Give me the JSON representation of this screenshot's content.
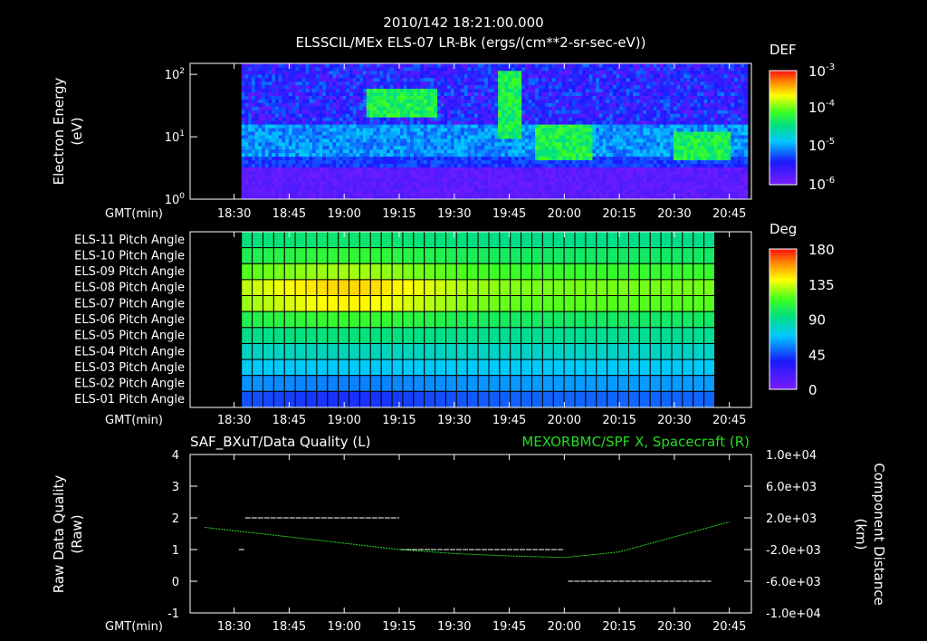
{
  "header": {
    "timestamp": "2010/142 18:21:00.000",
    "subtitle": "ELSSCIL/MEx ELS-07 LR-Bk  (ergs/(cm**2-sr-sec-eV))"
  },
  "colors": {
    "background": "#000000",
    "foreground": "#ffffff",
    "right_axis_title": "#22dd22"
  },
  "time_axis": {
    "label": "GMT(min)",
    "ticks": [
      "18:30",
      "18:45",
      "19:00",
      "19:15",
      "19:30",
      "19:45",
      "20:00",
      "20:15",
      "20:30",
      "20:45"
    ],
    "range_min": [
      18.3,
      20.85
    ]
  },
  "panel1": {
    "ylabel_line1": "Electron Energy",
    "ylabel_line2": "(eV)",
    "y_ticks": [
      {
        "base": "10",
        "exp": "0",
        "value": 1
      },
      {
        "base": "10",
        "exp": "1",
        "value": 10
      },
      {
        "base": "10",
        "exp": "2",
        "value": 100
      }
    ],
    "colorbar_title": "DEF",
    "colorbar_ticks": [
      {
        "base": "10",
        "exp": "-3"
      },
      {
        "base": "10",
        "exp": "-4"
      },
      {
        "base": "10",
        "exp": "-5"
      },
      {
        "base": "10",
        "exp": "-6"
      }
    ]
  },
  "panel2": {
    "row_labels": [
      "ELS-11 Pitch Angle",
      "ELS-10 Pitch Angle",
      "ELS-09 Pitch Angle",
      "ELS-08 Pitch Angle",
      "ELS-07 Pitch Angle",
      "ELS-06 Pitch Angle",
      "ELS-05 Pitch Angle",
      "ELS-04 Pitch Angle",
      "ELS-03 Pitch Angle",
      "ELS-02 Pitch Angle",
      "ELS-01 Pitch Angle"
    ],
    "colorbar_title": "Deg",
    "colorbar_ticks": [
      "180",
      "135",
      "90",
      "45",
      "0"
    ],
    "colorbar_range": [
      0,
      180
    ]
  },
  "panel3": {
    "left_title": "SAF_BXuT/Data Quality (L)",
    "right_title": "MEXORBMC/SPF X, Spacecraft (R)",
    "ylabel_left_line1": "Raw Data Quality",
    "ylabel_left_line2": "(Raw)",
    "ylabel_right_line1": "Component Distance",
    "ylabel_right_line2": "(km)",
    "left_ticks": [
      "4",
      "3",
      "2",
      "1",
      "0",
      "-1"
    ],
    "right_ticks": [
      "1.0e+04",
      "6.0e+03",
      "2.0e+03",
      "-2.0e+03",
      "-6.0e+03",
      "-1.0e+04"
    ]
  },
  "chart_data": [
    {
      "type": "heatmap",
      "title": "ELSSCIL/MEx ELS-07 LR-Bk  (ergs/(cm**2-sr-sec-eV))",
      "ylabel": "Electron Energy (eV)",
      "xlabel": "GMT(min)",
      "ylim": [
        1,
        150
      ],
      "y_scale": "log",
      "color_scale": "log",
      "color_range": [
        1e-06,
        0.001
      ],
      "data_start": "18:32",
      "features": [
        {
          "time_range": [
            "19:06",
            "19:25"
          ],
          "energy_eV": [
            20,
            60
          ],
          "level": "high (~3e-5 to 5e-5)"
        },
        {
          "time_range": [
            "19:42",
            "19:48"
          ],
          "energy_eV": [
            10,
            120
          ],
          "level": "high (~5e-5)"
        },
        {
          "time_range": [
            "19:52",
            "20:08"
          ],
          "energy_eV": [
            4,
            15
          ],
          "level": "moderate (~1e-5)"
        },
        {
          "time_range": [
            "20:30",
            "20:45"
          ],
          "energy_eV": [
            4,
            12
          ],
          "level": "moderate (~1e-5)"
        }
      ]
    },
    {
      "type": "heatmap",
      "title": "Pitch Angle",
      "xlabel": "GMT(min)",
      "categories": [
        "ELS-11",
        "ELS-10",
        "ELS-09",
        "ELS-08",
        "ELS-07",
        "ELS-06",
        "ELS-05",
        "ELS-04",
        "ELS-03",
        "ELS-02",
        "ELS-01"
      ],
      "color_range": [
        0,
        180
      ],
      "time_range": [
        "18:32",
        "20:41"
      ],
      "row_peak_values_deg": [
        98,
        110,
        128,
        148,
        142,
        112,
        95,
        82,
        70,
        55,
        40
      ],
      "row_end_values_deg": [
        92,
        100,
        112,
        122,
        118,
        100,
        90,
        80,
        70,
        60,
        50
      ]
    },
    {
      "type": "line",
      "series": [
        {
          "name": "SAF_BXuT/Data Quality (L)",
          "points": [
            {
              "x": "18:32",
              "y": 1
            },
            {
              "x": "18:33",
              "y": 2
            },
            {
              "x": "19:15",
              "y": 2
            },
            {
              "x": "19:15",
              "y": 1
            },
            {
              "x": "20:00",
              "y": 1
            },
            {
              "x": "20:01",
              "y": 0
            },
            {
              "x": "20:40",
              "y": 0
            }
          ],
          "ylim": [
            -1,
            4
          ]
        },
        {
          "name": "MEXORBMC/SPF X, Spacecraft (R)",
          "x": [
            "18:22",
            "18:45",
            "19:00",
            "19:15",
            "19:30",
            "19:45",
            "20:00",
            "20:15",
            "20:30",
            "20:45"
          ],
          "y": [
            800,
            -400,
            -1200,
            -2000,
            -2500,
            -2800,
            -3000,
            -2300,
            -400,
            1500
          ],
          "ylim": [
            -10000,
            10000
          ]
        }
      ]
    }
  ]
}
